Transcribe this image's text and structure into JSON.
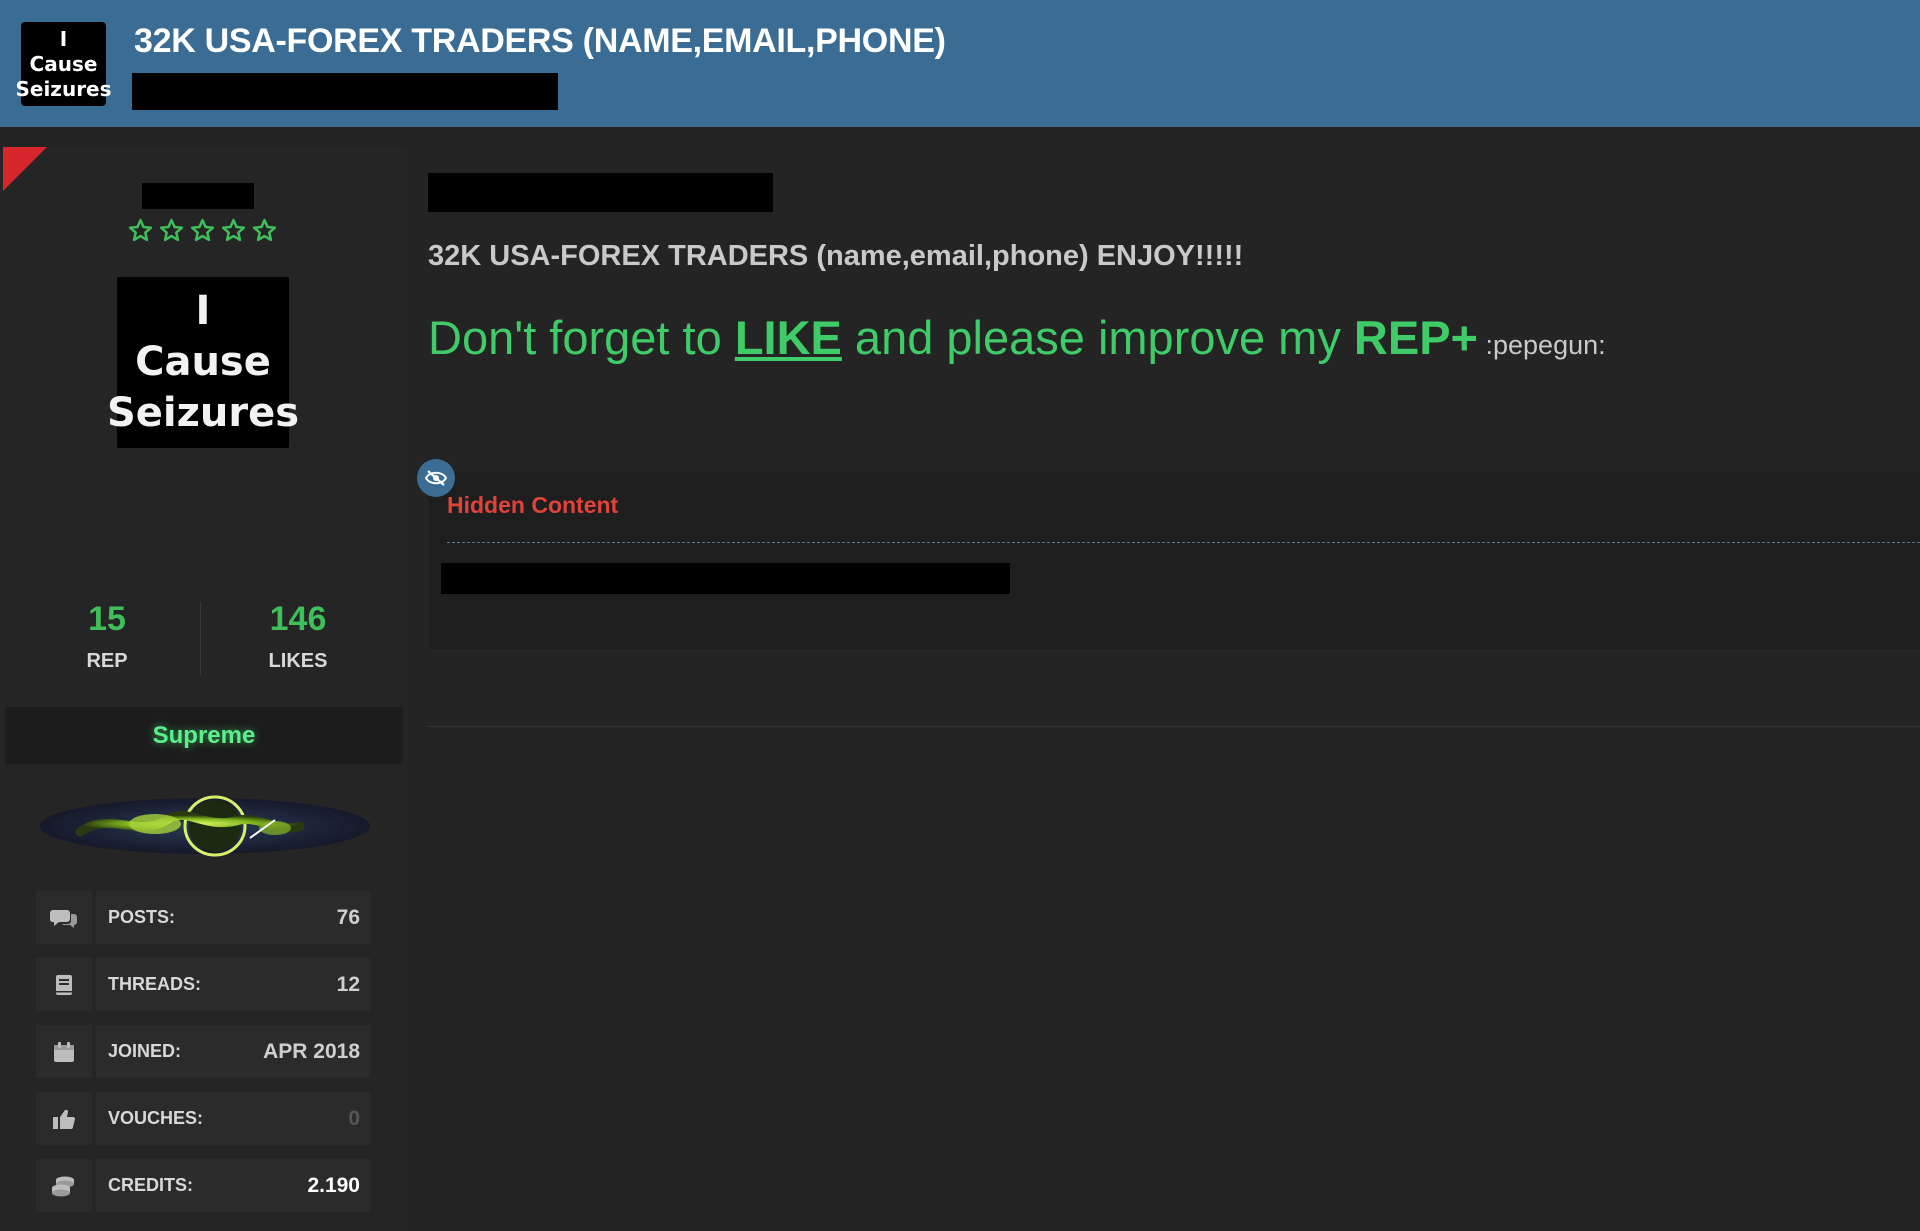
{
  "header": {
    "thumbnail_text": [
      "I",
      "Cause",
      "Seizures"
    ],
    "title": "32K USA-FOREX TRADERS (NAME,EMAIL,PHONE)",
    "background": "#3b6d94"
  },
  "user": {
    "stars": 5,
    "star_color": "#3fbf5a",
    "avatar_text": [
      "I",
      "Cause",
      "Seizures"
    ],
    "stats": {
      "rep_value": "15",
      "rep_label": "REP",
      "likes_value": "146",
      "likes_label": "LIKES"
    },
    "rank": "Supreme",
    "info": [
      {
        "icon": "comments-icon",
        "label": "POSTS:",
        "value": "76"
      },
      {
        "icon": "book-icon",
        "label": "THREADS:",
        "value": "12"
      },
      {
        "icon": "calendar-icon",
        "label": "JOINED:",
        "value": "APR 2018"
      },
      {
        "icon": "thumbs-up-icon",
        "label": "VOUCHES:",
        "value": "0"
      },
      {
        "icon": "coins-icon",
        "label": "CREDITS:",
        "value": "2.190"
      }
    ]
  },
  "post": {
    "body_line": "32K USA-FOREX TRADERS (name,email,phone) ENJOY!!!!!",
    "promo": {
      "part1": "Don't forget to ",
      "like": "LIKE",
      "part2": " and please improve my ",
      "rep": "REP+",
      "emote": " :pepegun:"
    },
    "hidden": {
      "title": "Hidden Content",
      "icon": "eye-slash-icon"
    }
  },
  "colors": {
    "accent_green": "#3ecb68",
    "hidden_red": "#e0433a",
    "corner_flag": "#d7262b"
  }
}
